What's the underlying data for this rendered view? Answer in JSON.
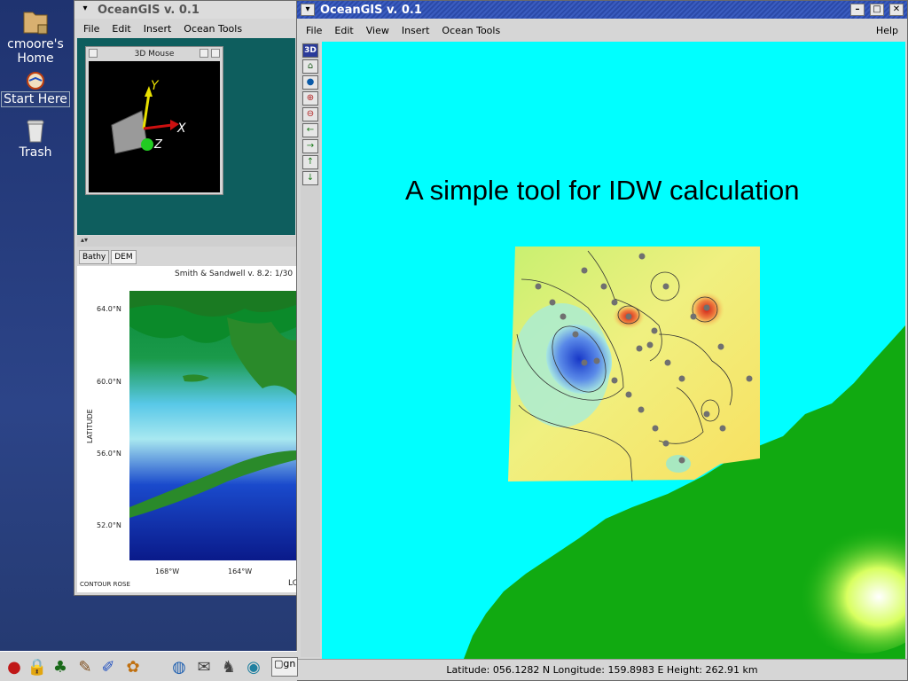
{
  "desktop": {
    "icons": [
      {
        "label": "cmoore's Home",
        "icon": "home-folder-icon"
      },
      {
        "label": "Start Here",
        "icon": "start-here-icon"
      },
      {
        "label": "Trash",
        "icon": "trash-icon"
      }
    ]
  },
  "back_window": {
    "title": "OceanGIS v. 0.1",
    "menus": [
      "File",
      "Edit",
      "Insert",
      "Ocean Tools"
    ],
    "mouse_panel": {
      "title": "3D Mouse",
      "axes": [
        "Y",
        "X",
        "Z"
      ]
    },
    "tabs": [
      "Bathy",
      "DEM"
    ],
    "map": {
      "title": "Smith & Sandwell v. 8.2: 1/30",
      "ylabel": "LATITUDE",
      "lat_ticks": [
        "64.0°N",
        "60.0°N",
        "56.0°N",
        "52.0°N"
      ],
      "lon_ticks": [
        "168°W",
        "164°W"
      ],
      "footer": "CONTOUR ROSE",
      "footer_right": "LO"
    }
  },
  "main_window": {
    "title": "OceanGIS v. 0.1",
    "menus": [
      "File",
      "Edit",
      "View",
      "Insert",
      "Ocean Tools"
    ],
    "help": "Help",
    "toolbar": {
      "three_d": "3D",
      "icons": [
        "home-icon",
        "globe-icon",
        "zoom-in-icon",
        "zoom-out-icon",
        "arrow-left-icon",
        "arrow-right-icon",
        "arrow-up-icon",
        "arrow-down-icon"
      ]
    },
    "slide_title": "A simple tool for IDW calculation",
    "status": "Latitude: 056.1282 N Longitude: 159.8983 E Height: 262.91 km"
  },
  "taskbar": {
    "task_label": "gn"
  },
  "colors": {
    "ocean": "#00ffff",
    "land": "#11aa11",
    "titlebar_active": "#2b4aa8",
    "desktop": "#2a3a78"
  }
}
